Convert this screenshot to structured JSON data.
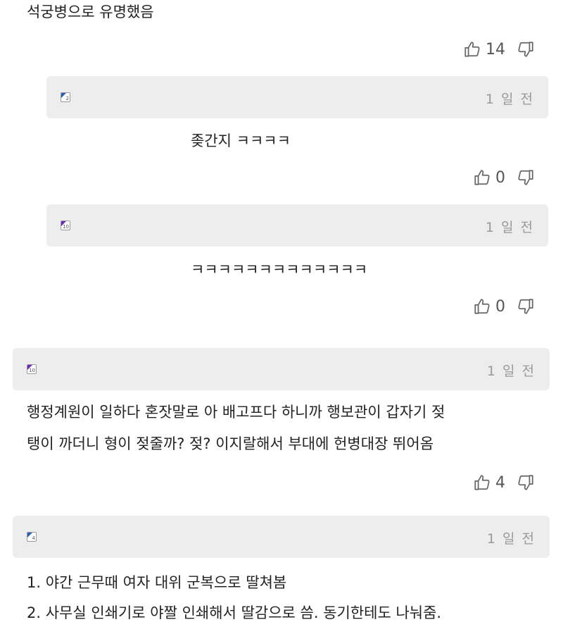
{
  "comments": [
    {
      "text_lines": [
        "석궁병으로 유명했음"
      ],
      "likes": "14"
    },
    {
      "level": "2",
      "badge_color": "#2a5fb0",
      "time": "1 일 전",
      "text_lines": [
        "좆간지 ㅋㅋㅋㅋ"
      ],
      "likes": "0"
    },
    {
      "level": "10",
      "badge_color": "#6a2bb8",
      "time": "1 일 전",
      "text_lines": [
        "ㅋㅋㅋㅋㅋㅋㅋㅋㅋㅋㅋㅋㅋ"
      ],
      "likes": "0"
    },
    {
      "level": "10",
      "badge_color": "#6a2bb8",
      "time": "1 일 전",
      "text_lines": [
        "행정계원이 일하다 혼잣말로 아 배고프다 하니까 행보관이 갑자기 젖",
        "탱이 까더니 형이 젖줄까? 젖? 이지랄해서 부대에 헌병대장 뛰어옴"
      ],
      "likes": "4"
    },
    {
      "level": "4",
      "badge_color": "#2a5fb0",
      "time": "1 일 전",
      "text_lines": [
        "1. 야간 근무때 여자 대위 군복으로 딸쳐봄",
        "2. 사무실 인쇄기로 야짤 인쇄해서 딸감으로 씀. 동기한테도 나눠줌."
      ]
    }
  ],
  "icons": {
    "like": "thumbs-up-icon",
    "dislike": "thumbs-down-icon"
  }
}
